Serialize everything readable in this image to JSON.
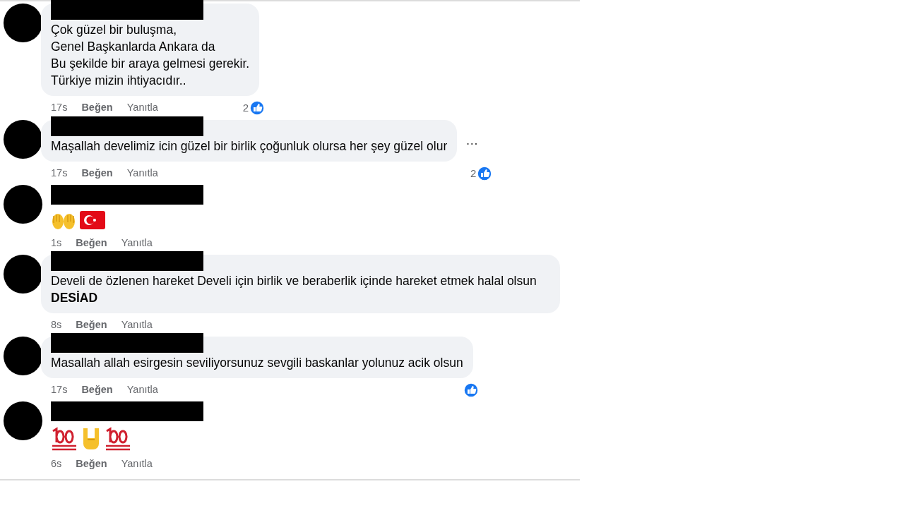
{
  "comments": [
    {
      "kind": "text",
      "lines": [
        "Çok güzel bir buluşma,",
        "Genel Başkanlarda Ankara da",
        "Bu şekilde bir araya gelmesi gerekir.",
        "Türkiye mizin ihtiyacıdır.."
      ],
      "time": "17s",
      "like_label": "Beğen",
      "reply_label": "Yanıtla",
      "reacted": true,
      "reaction_count": "2"
    },
    {
      "kind": "text",
      "lines": [
        "Maşallah develimiz icin güzel bir birlik çoğunluk olursa her şey güzel olur"
      ],
      "time": "17s",
      "like_label": "Beğen",
      "reply_label": "Yanıtla",
      "reacted": true,
      "reaction_count": "2",
      "menu": "…"
    },
    {
      "kind": "emoji",
      "emojis": [
        {
          "kind": "palms"
        },
        {
          "kind": "flag"
        }
      ],
      "time": "1s",
      "like_label": "Beğen",
      "reply_label": "Yanıtla",
      "reacted": false
    },
    {
      "kind": "text",
      "lines": [
        "Develi de özlenen hareket Develi için birlik ve beraberlik içinde hareket etmek halal olsun **DESİAD**"
      ],
      "time": "8s",
      "like_label": "Beğen",
      "reply_label": "Yanıtla",
      "reacted": false
    },
    {
      "kind": "text",
      "lines": [
        "Masallah allah esirgesin seviliyorsunuz sevgili baskanlar yolunuz acik olsun"
      ],
      "time": "17s",
      "like_label": "Beğen",
      "reply_label": "Yanıtla",
      "reacted": true
    },
    {
      "kind": "emoji",
      "emojis": [
        {
          "kind": "hundred"
        },
        {
          "kind": "horns"
        },
        {
          "kind": "hundred"
        }
      ],
      "time": "6s",
      "like_label": "Beğen",
      "reply_label": "Yanıtla",
      "reacted": false
    }
  ]
}
